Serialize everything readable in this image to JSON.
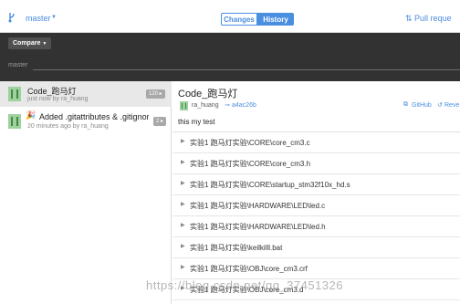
{
  "toolbar": {
    "branch": "master",
    "tab_changes": "Changes",
    "tab_history": "History",
    "pull_request": "Pull reque"
  },
  "compare": {
    "button_label": "Compare",
    "track_label": "master"
  },
  "commits": [
    {
      "title": "Code_跑马灯",
      "meta": "just now by ra_huang",
      "badge": "120 ▸",
      "selected": true
    },
    {
      "title": "Added .gitattributes & .gitignore",
      "meta": "20 minutes ago by ra_huang",
      "badge": "2 ▸",
      "selected": false
    }
  ],
  "detail": {
    "title": "Code_跑马灯",
    "author": "ra_huang",
    "sha": "a4ac26b",
    "github_link": "GitHub",
    "revert": "Reve",
    "message": "this my test",
    "files": [
      "实验1 跑马灯实验\\CORE\\core_cm3.c",
      "实验1 跑马灯实验\\CORE\\core_cm3.h",
      "实验1 跑马灯实验\\CORE\\startup_stm32f10x_hd.s",
      "实验1 跑马灯实验\\HARDWARE\\LED\\led.c",
      "实验1 跑马灯实验\\HARDWARE\\LED\\led.h",
      "实验1 跑马灯实验\\keilkilll.bat",
      "实验1 跑马灯实验\\OBJ\\core_cm3.crf",
      "实验1 跑马灯实验\\OBJ\\core_cm3.d"
    ]
  },
  "watermark": "https://blog.csdn.net/qq_37451326",
  "icons": {
    "branch": "branch-icon",
    "pull": "pull-request-icon",
    "sha": "commit-icon",
    "github": "github-icon",
    "revert": "revert-icon",
    "expand": "chevron-right-icon"
  },
  "colors": {
    "accent": "#4a8ee0",
    "dark_bar": "#323232",
    "avatar_green": "#9fd09f"
  }
}
